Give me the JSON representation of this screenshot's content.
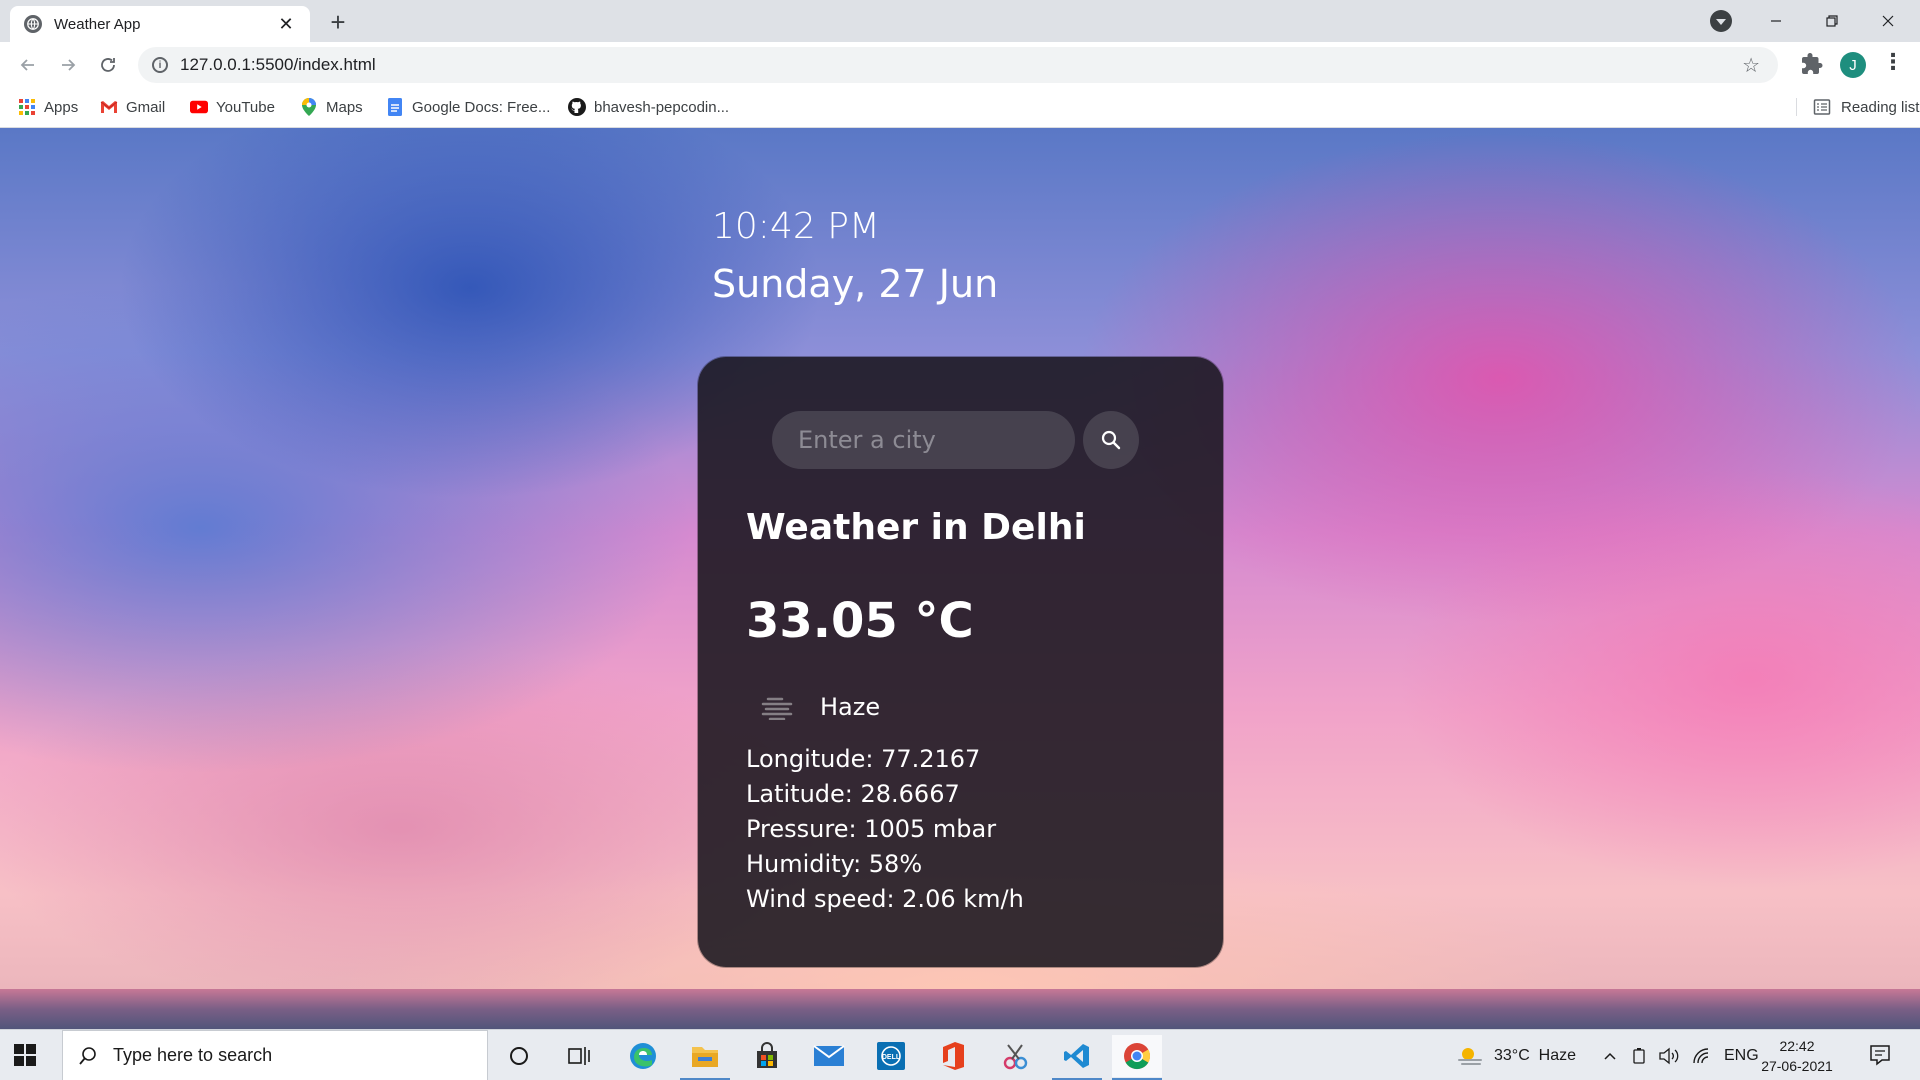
{
  "browser": {
    "tab_title": "Weather App",
    "url": "127.0.0.1:5500/index.html",
    "profile_initial": "J",
    "bookmarks": [
      {
        "label": "Apps",
        "icon": "apps-grid-icon"
      },
      {
        "label": "Gmail",
        "icon": "gmail-icon"
      },
      {
        "label": "YouTube",
        "icon": "youtube-icon"
      },
      {
        "label": "Maps",
        "icon": "maps-pin-icon"
      },
      {
        "label": "Google Docs: Free...",
        "icon": "google-docs-icon"
      },
      {
        "label": "bhavesh-pepcodin...",
        "icon": "github-icon"
      }
    ],
    "reading_list": "Reading list"
  },
  "page": {
    "time": "10:42 PM",
    "date": "Sunday, 27 Jun",
    "search_placeholder": "Enter a city",
    "title": "Weather in Delhi",
    "temperature": "33.05 °C",
    "description": "Haze",
    "details": {
      "longitude": "Longitude: 77.2167",
      "latitude": "Latitude: 28.6667",
      "pressure": "Pressure: 1005 mbar",
      "humidity": "Humidity: 58%",
      "wind": "Wind speed: 2.06 km/h"
    }
  },
  "taskbar": {
    "search_placeholder": "Type here to search",
    "weather": "33°C  Haze",
    "language": "ENG",
    "time": "22:42",
    "date": "27-06-2021"
  },
  "colors": {
    "card_bg": "#19161e",
    "accent_profile": "#1e8e7e",
    "taskbar_bg": "#e8ebf0"
  }
}
